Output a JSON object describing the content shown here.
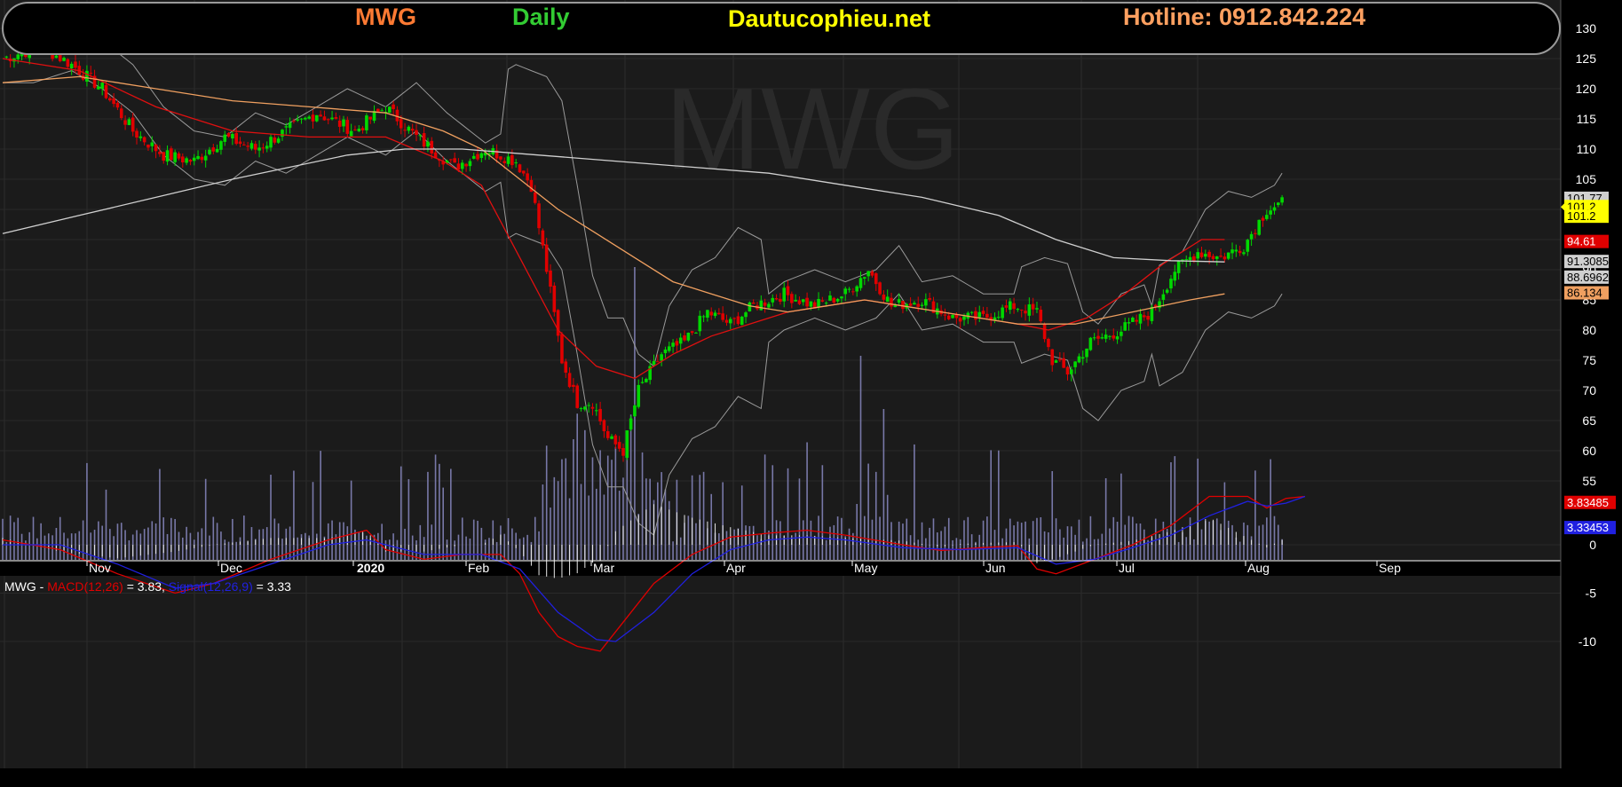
{
  "header": {
    "symbol": "MWG",
    "period": "Daily",
    "site": "Dautucophieu.net",
    "hotline": "Hotline: 0912.842.224",
    "watermark": "MWG"
  },
  "colors": {
    "up": "#00d800",
    "down": "#e00000",
    "ma_fast": "#e01010",
    "ma_mid": "#f0a060",
    "ma_slow": "#d0d0d0",
    "bollinger": "#9a9a9a",
    "volume": "#7878a8",
    "macd": "#e00000",
    "signal": "#2020e0",
    "symbol": "#ff7a33",
    "period": "#33cc33",
    "site": "#ffff00",
    "hotline": "#ffa060"
  },
  "chart_data": [
    {
      "type": "candlestick",
      "ylim": [
        53,
        131
      ],
      "yticks": [
        "130",
        "125",
        "120",
        "115",
        "110",
        "105",
        "100",
        "95",
        "90",
        "85",
        "80",
        "75",
        "70",
        "65",
        "60",
        "55"
      ],
      "xlabels": [
        "Nov",
        "Dec",
        "2020",
        "Feb",
        "Mar",
        "Apr",
        "May",
        "Jun",
        "Jul",
        "Aug",
        "Sep"
      ],
      "series": [
        {
          "name": "ma_fast",
          "values": [
            [
              0,
              125
            ],
            [
              20,
              123
            ],
            [
              40,
              117
            ],
            [
              60,
              113
            ],
            [
              80,
              112
            ],
            [
              100,
              112
            ],
            [
              115,
              108
            ],
            [
              125,
              104
            ],
            [
              135,
              92
            ],
            [
              145,
              80
            ],
            [
              155,
              74
            ],
            [
              165,
              72
            ],
            [
              175,
              76
            ],
            [
              185,
              79
            ],
            [
              195,
              81
            ],
            [
              205,
              83
            ],
            [
              215,
              84
            ],
            [
              225,
              85
            ],
            [
              235,
              84
            ],
            [
              245,
              83
            ],
            [
              255,
              82
            ],
            [
              265,
              81
            ],
            [
              273,
              80
            ],
            [
              283,
              82
            ],
            [
              293,
              86
            ],
            [
              303,
              91
            ],
            [
              313,
              95
            ],
            [
              319,
              95
            ]
          ]
        },
        {
          "name": "ma_mid",
          "values": [
            [
              0,
              121
            ],
            [
              20,
              122
            ],
            [
              40,
              120
            ],
            [
              60,
              118
            ],
            [
              80,
              117
            ],
            [
              100,
              116
            ],
            [
              115,
              113
            ],
            [
              125,
              110
            ],
            [
              135,
              105
            ],
            [
              145,
              100
            ],
            [
              155,
              96
            ],
            [
              165,
              92
            ],
            [
              175,
              88
            ],
            [
              185,
              86
            ],
            [
              195,
              84
            ],
            [
              205,
              83
            ],
            [
              215,
              84
            ],
            [
              225,
              85
            ],
            [
              235,
              84
            ],
            [
              245,
              83
            ],
            [
              255,
              82
            ],
            [
              265,
              81
            ],
            [
              280,
              81
            ],
            [
              295,
              83
            ],
            [
              310,
              85
            ],
            [
              319,
              86
            ]
          ]
        },
        {
          "name": "ma_slow",
          "values": [
            [
              0,
              96
            ],
            [
              20,
              99
            ],
            [
              40,
              102
            ],
            [
              60,
              105
            ],
            [
              75,
              107
            ],
            [
              90,
              109
            ],
            [
              105,
              110
            ],
            [
              120,
              110
            ],
            [
              140,
              109
            ],
            [
              160,
              108
            ],
            [
              180,
              107
            ],
            [
              200,
              106
            ],
            [
              220,
              104
            ],
            [
              240,
              102
            ],
            [
              260,
              99
            ],
            [
              275,
              95
            ],
            [
              290,
              92
            ],
            [
              305,
              91.5
            ],
            [
              319,
              91.3
            ]
          ]
        }
      ],
      "price_labels": [
        {
          "value": "101.77",
          "y": 101.77,
          "bg": "#d0d0d0",
          "fg": "#000000"
        },
        {
          "value": "101.2",
          "y": 100.4,
          "bg": "#ffff00",
          "fg": "#000000"
        },
        {
          "value": "101.2",
          "y": 98.8,
          "bg": "#ffff00",
          "fg": "#000000"
        },
        {
          "value": "94.61",
          "y": 94.61,
          "bg": "#e00000",
          "fg": "#ffffff"
        },
        {
          "value": "91.3085",
          "y": 91.3,
          "bg": "#d0d0d0",
          "fg": "#000000"
        },
        {
          "value": "88.6962",
          "y": 88.7,
          "bg": "#d0d0d0",
          "fg": "#000000"
        },
        {
          "value": "86.134",
          "y": 86.1,
          "bg": "#f0a060",
          "fg": "#000000"
        }
      ]
    },
    {
      "type": "macd",
      "legend_prefix": "MWG - ",
      "macd_label": "MACD(12,26)",
      "macd_value": " = 3.83, ",
      "signal_label": "Signal(12,26,9)",
      "signal_value": " = 3.33",
      "ylim": [
        -11,
        6
      ],
      "yticks": [
        "0",
        "-5",
        "-10"
      ],
      "series": [
        {
          "name": "macd",
          "values": [
            [
              0,
              0.5
            ],
            [
              15,
              -0.5
            ],
            [
              30,
              -3
            ],
            [
              45,
              -5
            ],
            [
              55,
              -4
            ],
            [
              70,
              -1.5
            ],
            [
              85,
              0.5
            ],
            [
              95,
              1.5
            ],
            [
              100,
              -0.5
            ],
            [
              110,
              -1.5
            ],
            [
              120,
              -1
            ],
            [
              130,
              -1
            ],
            [
              135,
              -3
            ],
            [
              140,
              -7
            ],
            [
              145,
              -9.5
            ],
            [
              150,
              -10.5
            ],
            [
              156,
              -11
            ],
            [
              162,
              -8
            ],
            [
              170,
              -4
            ],
            [
              180,
              -1
            ],
            [
              190,
              0.8
            ],
            [
              200,
              1.2
            ],
            [
              210,
              1.5
            ],
            [
              220,
              1
            ],
            [
              235,
              0
            ],
            [
              245,
              -0.6
            ],
            [
              255,
              -0.3
            ],
            [
              265,
              -0.1
            ],
            [
              270,
              -2.5
            ],
            [
              275,
              -3
            ],
            [
              285,
              -1.5
            ],
            [
              295,
              0
            ],
            [
              305,
              2
            ],
            [
              315,
              5
            ],
            [
              325,
              5
            ],
            [
              330,
              3.8
            ],
            [
              335,
              4.8
            ],
            [
              340,
              5
            ]
          ]
        },
        {
          "name": "signal",
          "values": [
            [
              0,
              0
            ],
            [
              15,
              0
            ],
            [
              30,
              -2
            ],
            [
              45,
              -4.5
            ],
            [
              55,
              -4
            ],
            [
              70,
              -2
            ],
            [
              85,
              0
            ],
            [
              95,
              0.5
            ],
            [
              100,
              0
            ],
            [
              110,
              -1
            ],
            [
              125,
              -1
            ],
            [
              135,
              -2.5
            ],
            [
              145,
              -7
            ],
            [
              155,
              -9.8
            ],
            [
              160,
              -10
            ],
            [
              170,
              -7
            ],
            [
              180,
              -3
            ],
            [
              190,
              -0.5
            ],
            [
              200,
              0.5
            ],
            [
              210,
              0.8
            ],
            [
              220,
              0.5
            ],
            [
              235,
              -0.3
            ],
            [
              250,
              -0.5
            ],
            [
              265,
              -0.3
            ],
            [
              275,
              -2
            ],
            [
              285,
              -1.5
            ],
            [
              295,
              -0.3
            ],
            [
              305,
              1
            ],
            [
              315,
              3
            ],
            [
              325,
              4.5
            ],
            [
              330,
              4
            ],
            [
              335,
              4.3
            ],
            [
              340,
              5
            ]
          ]
        }
      ]
    }
  ]
}
